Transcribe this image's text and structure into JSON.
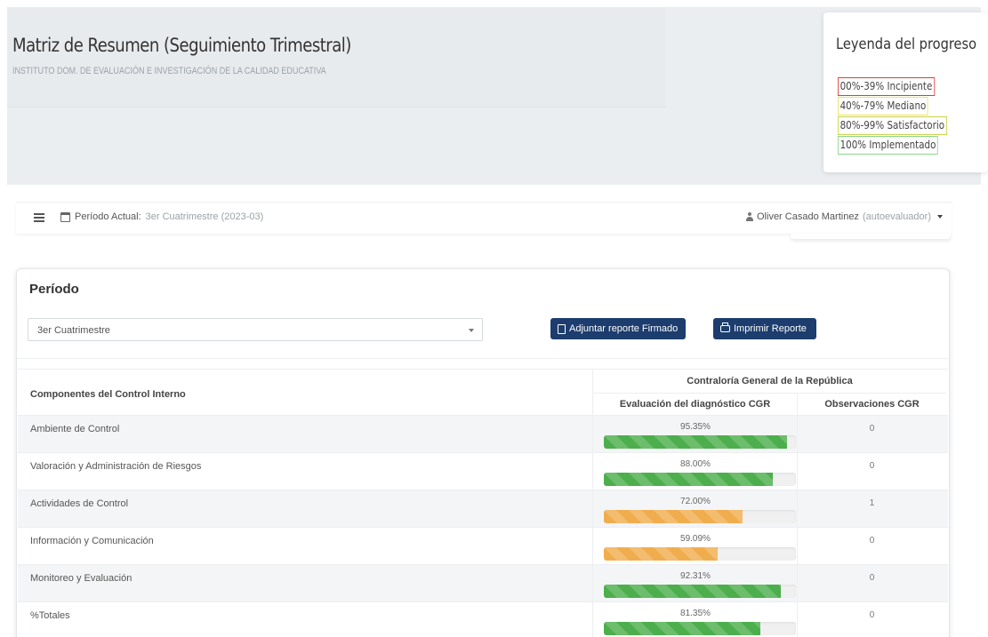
{
  "header": {
    "title": "Matriz de Resumen (Seguimiento Trimestral)",
    "subtitle": "INSTITUTO DOM. DE EVALUACIÓN E INVESTIGACIÓN DE LA CALIDAD EDUCATIVA"
  },
  "legend": {
    "title": "Leyenda del progreso",
    "items": [
      {
        "label": "00%-39% Incipiente",
        "color": "#e53935"
      },
      {
        "label": "40%-79% Mediano",
        "color": "#f2e25b"
      },
      {
        "label": "80%-99% Satisfactorio",
        "color": "#c9d44a"
      },
      {
        "label": "100% Implementado",
        "color": "#8fd48c"
      }
    ]
  },
  "navbar": {
    "period_label": "Período Actual:",
    "period_value": "3er Cuatrimestre (2023-03)",
    "user_name": "Oliver Casado Martinez",
    "user_role": "(autoevaluador)"
  },
  "card": {
    "title": "Período",
    "select_value": "3er Cuatrimestre",
    "attach_button": "Adjuntar reporte Firmado",
    "print_button": "Imprimir Reporte"
  },
  "table": {
    "col_components": "Componentes del Control Interno",
    "col_group": "Contraloría General de la República",
    "col_eval": "Evaluación del diagnóstico CGR",
    "col_obs": "Observaciones CGR",
    "rows": [
      {
        "name": "Ambiente de Control",
        "pct": "95.35%",
        "value": 95.35,
        "obs": "0"
      },
      {
        "name": "Valoración y Administración de Riesgos",
        "pct": "88.00%",
        "value": 88.0,
        "obs": "0"
      },
      {
        "name": "Actividades de Control",
        "pct": "72.00%",
        "value": 72.0,
        "obs": "1"
      },
      {
        "name": "Información y Comunicación",
        "pct": "59.09%",
        "value": 59.09,
        "obs": "0"
      },
      {
        "name": "Monitoreo y Evaluación",
        "pct": "92.31%",
        "value": 92.31,
        "obs": "0"
      },
      {
        "name": "%Totales",
        "pct": "81.35%",
        "value": 81.35,
        "obs": "0"
      }
    ]
  },
  "colors": {
    "bar_green": "#4cae4c",
    "bar_orange": "#f0ad4e",
    "button_navy": "#1c3d6e"
  }
}
